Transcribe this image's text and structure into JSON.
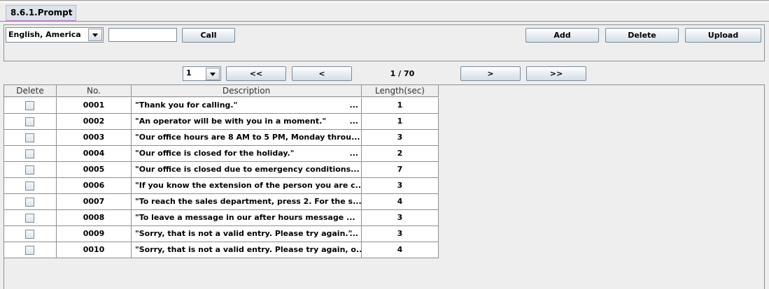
{
  "tab": {
    "label": "8.6.1.Prompt"
  },
  "toolbar": {
    "language": "English, America",
    "call_input_value": "",
    "call_label": "Call",
    "add_label": "Add",
    "delete_label": "Delete",
    "upload_label": "Upload"
  },
  "pagination": {
    "page_select": "1",
    "first_label": "<<",
    "prev_label": "<",
    "status": "1 / 70",
    "next_label": ">",
    "last_label": ">>"
  },
  "table": {
    "headers": [
      "Delete",
      "No.",
      "Description",
      "Length(sec)"
    ],
    "rows": [
      {
        "no": "0001",
        "description": "\"Thank you for calling.\"",
        "ellipsis": "...",
        "length": "1"
      },
      {
        "no": "0002",
        "description": "\"An operator will be with you in a moment.\"",
        "ellipsis": "...",
        "length": "1"
      },
      {
        "no": "0003",
        "description": "\"Our office hours are 8 AM to 5 PM, Monday throu...",
        "ellipsis": "",
        "length": "3"
      },
      {
        "no": "0004",
        "description": "\"Our office is closed for the holiday.\"",
        "ellipsis": "...",
        "length": "2"
      },
      {
        "no": "0005",
        "description": "\"Our office is closed due to emergency conditions...",
        "ellipsis": "",
        "length": "7"
      },
      {
        "no": "0006",
        "description": "\"If you know the extension of the person you are c...",
        "ellipsis": "",
        "length": "3"
      },
      {
        "no": "0007",
        "description": "\"To reach the sales department, press 2. For the s...",
        "ellipsis": "",
        "length": "4"
      },
      {
        "no": "0008",
        "description": "\"To leave a message in our after hours message ...",
        "ellipsis": "",
        "length": "3"
      },
      {
        "no": "0009",
        "description": "\"Sorry, that is not a valid entry. Please try again.\"",
        "ellipsis": "...",
        "length": "3"
      },
      {
        "no": "0010",
        "description": "\"Sorry, that is not a valid entry. Please try again, o...",
        "ellipsis": "",
        "length": "4"
      }
    ]
  }
}
